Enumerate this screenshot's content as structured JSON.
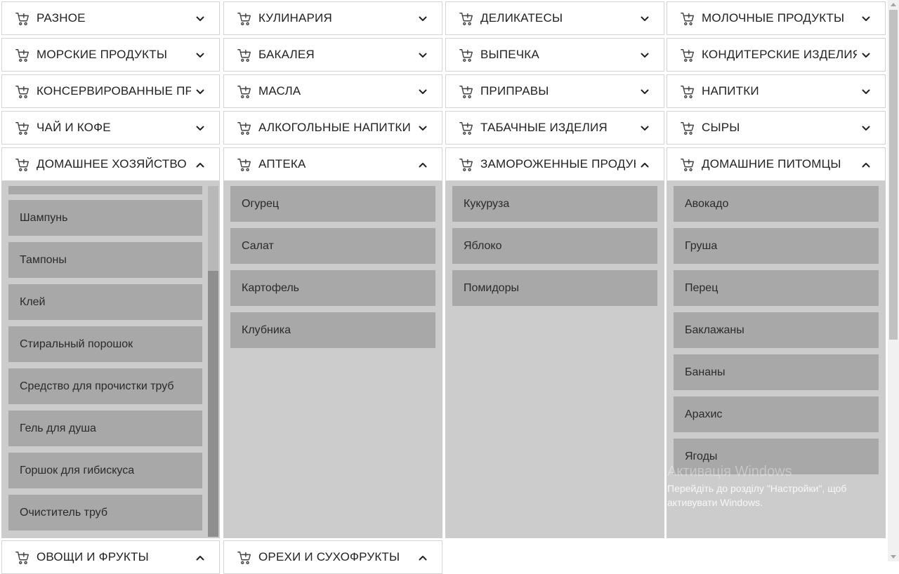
{
  "categories": [
    {
      "label": "РАЗНОЕ",
      "open": false
    },
    {
      "label": "КУЛИНАРИЯ",
      "open": false
    },
    {
      "label": "ДЕЛИКАТЕСЫ",
      "open": false
    },
    {
      "label": "МОЛОЧНЫЕ ПРОДУКТЫ",
      "open": false
    },
    {
      "label": "МОРСКИЕ ПРОДУКТЫ",
      "open": false
    },
    {
      "label": "БАКАЛЕЯ",
      "open": false
    },
    {
      "label": "ВЫПЕЧКА",
      "open": false
    },
    {
      "label": "КОНДИТЕРСКИЕ ИЗДЕЛИЯ",
      "open": false
    },
    {
      "label": "КОНСЕРВИРОВАННЫЕ ПРОДУКТЫ",
      "open": false
    },
    {
      "label": "МАСЛА",
      "open": false
    },
    {
      "label": "ПРИПРАВЫ",
      "open": false
    },
    {
      "label": "НАПИТКИ",
      "open": false
    },
    {
      "label": "ЧАЙ И КОФЕ",
      "open": false
    },
    {
      "label": "АЛКОГОЛЬНЫЕ НАПИТКИ",
      "open": false
    },
    {
      "label": "ТАБАЧНЫЕ ИЗДЕЛИЯ",
      "open": false
    },
    {
      "label": "СЫРЫ",
      "open": false
    },
    {
      "label": "ДОМАШНЕЕ ХОЗЯЙСТВО",
      "open": true
    },
    {
      "label": "АПТЕКА",
      "open": true
    },
    {
      "label": "ЗАМОРОЖЕННЫЕ ПРОДУКТЫ",
      "open": true
    },
    {
      "label": "ДОМАШНИЕ ПИТОМЦЫ",
      "open": true
    },
    {
      "label": "ОВОЩИ И ФРУКТЫ",
      "open": true
    },
    {
      "label": "ОРЕХИ И СУХОФРУКТЫ",
      "open": true
    }
  ],
  "panels": {
    "household": [
      "Шампунь",
      "Тампоны",
      "Клей",
      "Стиральный порошок",
      "Средство для прочистки труб",
      "Гель для душа",
      "Горшок для гибискуса",
      "Очиститель труб"
    ],
    "pharmacy": [
      "Огурец",
      "Салат",
      "Картофель",
      "Клубника"
    ],
    "frozen": [
      "Кукуруза",
      "Яблоко",
      "Помидоры"
    ],
    "pets": [
      "Авокадо",
      "Груша",
      "Перец",
      "Баклажаны",
      "Бананы",
      "Арахис",
      "Ягоды"
    ]
  },
  "icons": {
    "category": "cart-plus-icon",
    "collapsed": "chevron-down-icon",
    "expanded": "chevron-up-icon"
  },
  "watermark": {
    "title": "Активація Windows",
    "line1": "Перейдіть до розділу \"Настройки\", щоб",
    "line2": "активувати Windows."
  },
  "colors": {
    "panel": "#cccccc",
    "item": "#a8a8a8",
    "header": "#ffffff",
    "border": "#d4d4d4"
  }
}
